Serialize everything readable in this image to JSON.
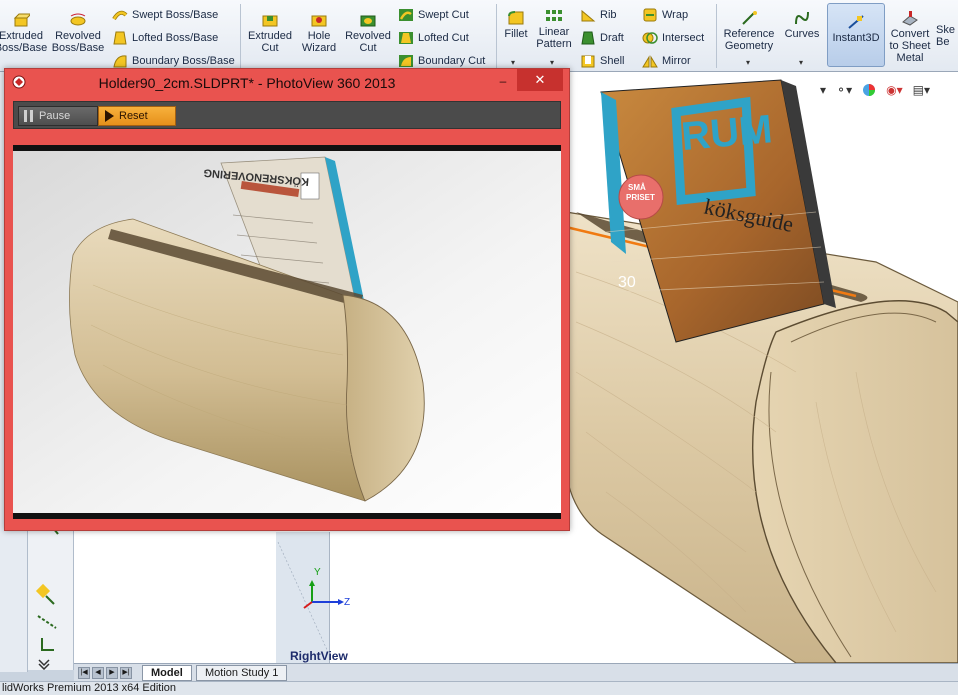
{
  "ribbon": {
    "extruded_boss_l1": "Extruded",
    "extruded_boss_l2": "Boss/Base",
    "revolved_boss_l1": "Revolved",
    "revolved_boss_l2": "Boss/Base",
    "swept_boss": "Swept Boss/Base",
    "lofted_boss": "Lofted Boss/Base",
    "boundary_boss": "Boundary Boss/Base",
    "extruded_cut_l1": "Extruded",
    "extruded_cut_l2": "Cut",
    "hole_wizard_l1": "Hole",
    "hole_wizard_l2": "Wizard",
    "revolved_cut_l1": "Revolved",
    "revolved_cut_l2": "Cut",
    "swept_cut": "Swept Cut",
    "lofted_cut": "Lofted Cut",
    "boundary_cut": "Boundary Cut",
    "fillet": "Fillet",
    "linear_pattern_l1": "Linear",
    "linear_pattern_l2": "Pattern",
    "rib": "Rib",
    "draft": "Draft",
    "shell": "Shell",
    "wrap": "Wrap",
    "intersect": "Intersect",
    "mirror": "Mirror",
    "ref_geometry_l1": "Reference",
    "ref_geometry_l2": "Geometry",
    "curves": "Curves",
    "instant3d": "Instant3D",
    "convert_l1": "Convert",
    "convert_l2": "to Sheet",
    "convert_l3": "Metal",
    "sketch_l1": "Ske",
    "sketch_l2": "Be"
  },
  "photoview": {
    "title": "Holder90_2cm.SLDPRT* - PhotoView 360 2013",
    "minimize": "–",
    "close": "✕",
    "pause": "Pause",
    "reset": "Reset"
  },
  "magazine": {
    "title": "RUM",
    "subtitle": "köksguide",
    "badge_l1": "SMÅ",
    "badge_l2": "PRISET",
    "issue": "30",
    "render_title": "KÖKSRENOVERING"
  },
  "viewport": {
    "view_label": "RightView",
    "axis_y": "Y",
    "axis_z": "Z"
  },
  "tabs": {
    "model": "Model",
    "motion_study": "Motion Study 1"
  },
  "status": {
    "text": "lidWorks Premium 2013 x64 Edition"
  },
  "colors": {
    "pv_frame": "#e9534f",
    "pv_close": "#c7312e",
    "reset_accent": "#f0a02a",
    "wood": "#dcc9a4",
    "magazine_cover": "#2fa3c7",
    "selection_edge": "#f07a12"
  }
}
